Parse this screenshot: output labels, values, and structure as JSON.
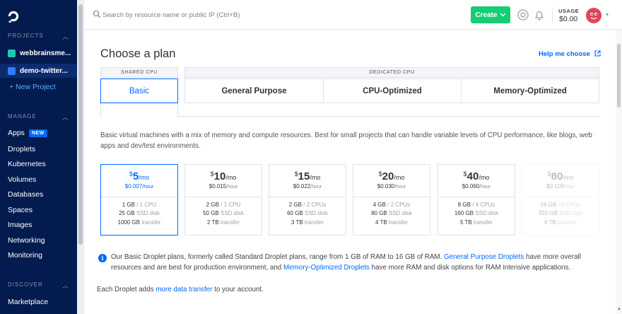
{
  "sidebar": {
    "projects_heading": "PROJECTS",
    "projects": [
      {
        "label": "webbrainsme...",
        "color": "#1fc8b0"
      },
      {
        "label": "demo-twitter...",
        "color": "#2f7bff"
      }
    ],
    "new_project": "+ New Project",
    "manage_heading": "MANAGE",
    "manage_items": [
      {
        "label": "Apps",
        "badge": "NEW"
      },
      {
        "label": "Droplets"
      },
      {
        "label": "Kubernetes"
      },
      {
        "label": "Volumes"
      },
      {
        "label": "Databases"
      },
      {
        "label": "Spaces"
      },
      {
        "label": "Images"
      },
      {
        "label": "Networking"
      },
      {
        "label": "Monitoring"
      }
    ],
    "discover_heading": "DISCOVER",
    "discover_items": [
      {
        "label": "Marketplace"
      }
    ]
  },
  "topbar": {
    "search_placeholder": "Search by resource name or public IP (Ctrl+B)",
    "create_label": "Create",
    "usage_label": "USAGE",
    "usage_value": "$0.00"
  },
  "plan": {
    "title": "Choose a plan",
    "help_link": "Help me choose",
    "shared_heading": "SHARED CPU",
    "dedicated_heading": "DEDICATED CPU",
    "tabs": [
      "Basic",
      "General Purpose",
      "CPU-Optimized",
      "Memory-Optimized"
    ],
    "selected_tab": "Basic",
    "description": "Basic virtual machines with a mix of memory and compute resources. Best for small projects that can handle variable levels of CPU performance, like blogs, web apps and dev/test environments.",
    "cards": [
      {
        "currency": "$",
        "price": "5",
        "per": "/mo",
        "hourly": "$0.007",
        "hour_unit": "/hour",
        "mem": "1 GB",
        "cpu": "1 CPU",
        "disk": "25 GB",
        "disk_unit": "SSD disk",
        "transfer": "1000 GB",
        "transfer_unit": "transfer",
        "selected": true,
        "disabled": false
      },
      {
        "currency": "$",
        "price": "10",
        "per": "/mo",
        "hourly": "$0.015",
        "hour_unit": "/hour",
        "mem": "2 GB",
        "cpu": "1 CPU",
        "disk": "50 GB",
        "disk_unit": "SSD disk",
        "transfer": "2 TB",
        "transfer_unit": "transfer",
        "selected": false,
        "disabled": false
      },
      {
        "currency": "$",
        "price": "15",
        "per": "/mo",
        "hourly": "$0.022",
        "hour_unit": "/hour",
        "mem": "2 GB",
        "cpu": "2 CPUs",
        "disk": "60 GB",
        "disk_unit": "SSD disk",
        "transfer": "3 TB",
        "transfer_unit": "transfer",
        "selected": false,
        "disabled": false
      },
      {
        "currency": "$",
        "price": "20",
        "per": "/mo",
        "hourly": "$0.030",
        "hour_unit": "/hour",
        "mem": "4 GB",
        "cpu": "2 CPUs",
        "disk": "80 GB",
        "disk_unit": "SSD disk",
        "transfer": "4 TB",
        "transfer_unit": "transfer",
        "selected": false,
        "disabled": false
      },
      {
        "currency": "$",
        "price": "40",
        "per": "/mo",
        "hourly": "$0.060",
        "hour_unit": "/hour",
        "mem": "8 GB",
        "cpu": "4 CPUs",
        "disk": "160 GB",
        "disk_unit": "SSD disk",
        "transfer": "5 TB",
        "transfer_unit": "transfer",
        "selected": false,
        "disabled": false
      },
      {
        "currency": "$",
        "price": "80",
        "per": "/mo",
        "hourly": "$0.119",
        "hour_unit": "/hour",
        "mem": "16 GB",
        "cpu": "4 CPUs",
        "disk": "320 GB",
        "disk_unit": "SSD disk",
        "transfer": "6 TB",
        "transfer_unit": "transfer",
        "selected": false,
        "disabled": true
      }
    ],
    "info_part1": "Our Basic Droplet plans, formerly called Standard Droplet plans, range from 1 GB of RAM to 16 GB of RAM. ",
    "info_link1": "General Purpose Droplets",
    "info_part2": " have more overall resources and are best for production environment, and ",
    "info_link2": "Memory-Optimized Droplets",
    "info_part3": " have more RAM and disk options for RAM intensive applications.",
    "footer_part1": "Each Droplet adds ",
    "footer_link": "more data transfer",
    "footer_part2": " to your account."
  },
  "colors": {
    "accent": "#0069ff",
    "sidebar": "#031b4e",
    "create": "#15cd72"
  }
}
